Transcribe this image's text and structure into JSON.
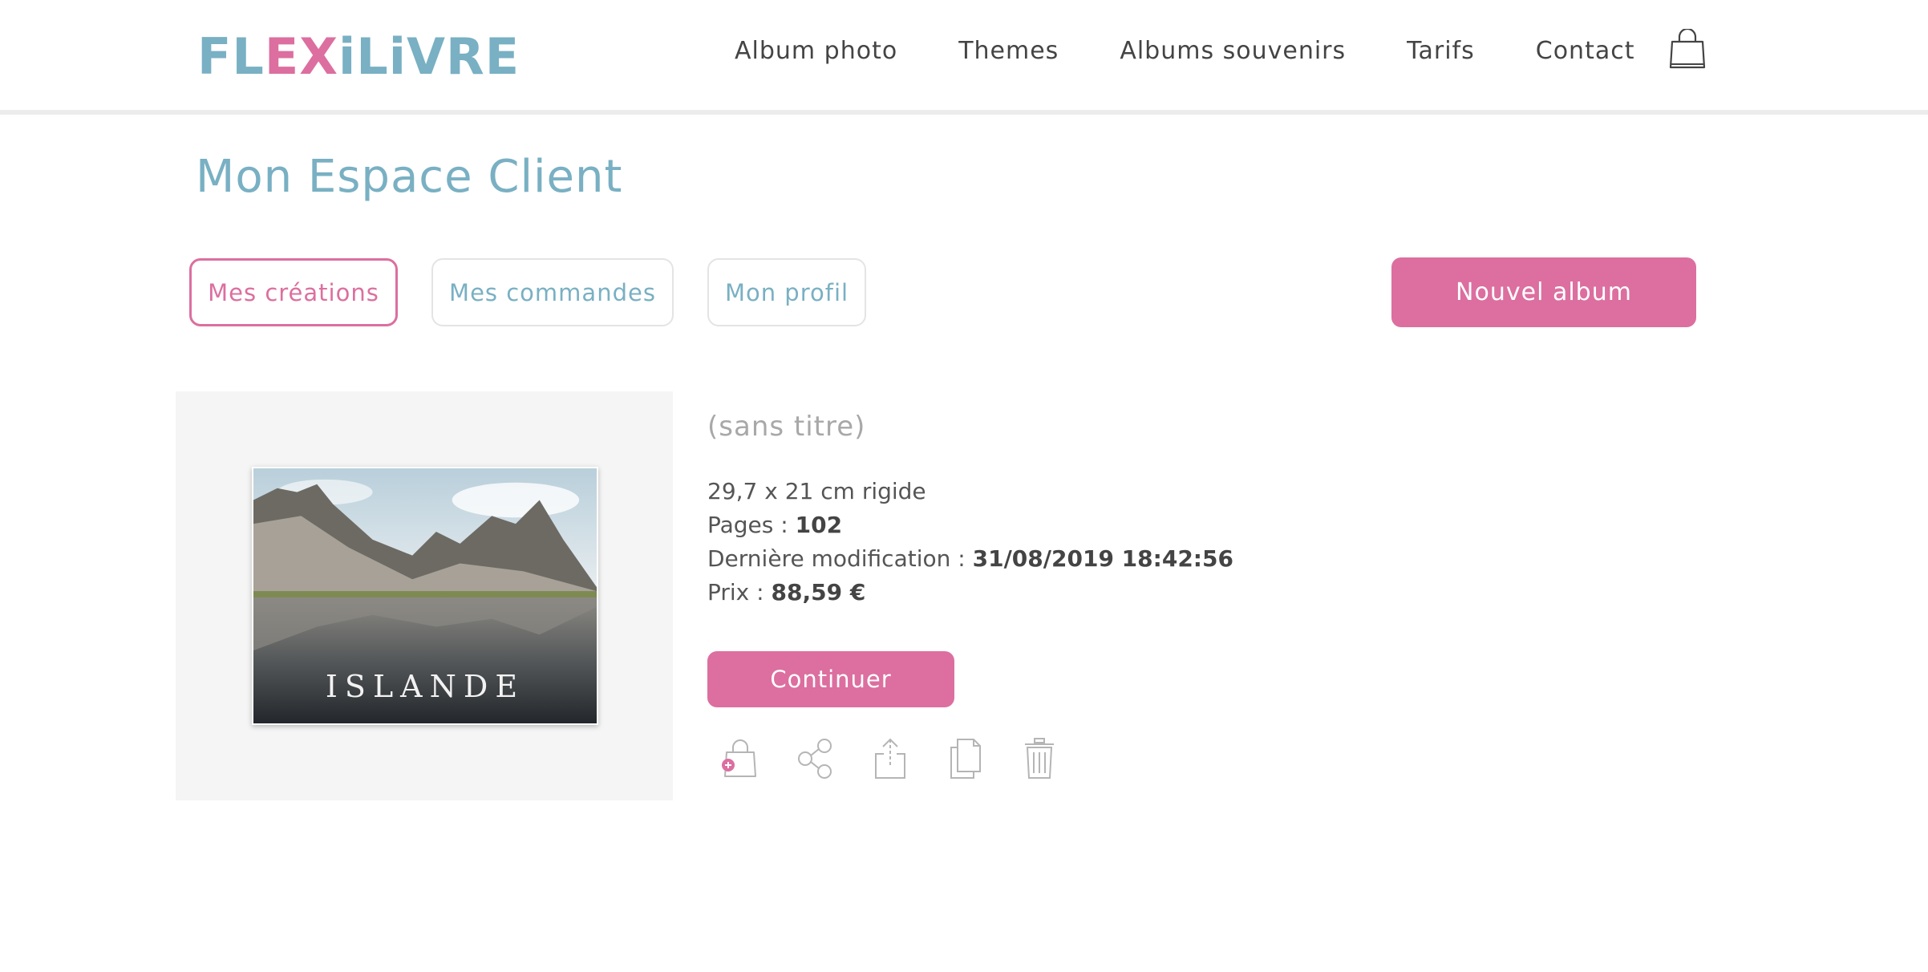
{
  "header": {
    "logo": {
      "part1": "FL",
      "part2": "EX",
      "part3": "iLiVRE"
    },
    "nav": [
      {
        "label": "Album photo"
      },
      {
        "label": "Themes"
      },
      {
        "label": "Albums souvenirs"
      },
      {
        "label": "Tarifs"
      },
      {
        "label": "Contact"
      }
    ],
    "cart_icon": "shopping-bag-icon"
  },
  "main": {
    "title": "Mon Espace Client",
    "tabs": [
      {
        "label": "Mes créations",
        "active": true
      },
      {
        "label": "Mes commandes",
        "active": false
      },
      {
        "label": "Mon profil",
        "active": false
      }
    ],
    "new_album_label": "Nouvel album",
    "album": {
      "cover_text": "ISLANDE",
      "title": "(sans titre)",
      "format": "29,7 x 21 cm rigide",
      "pages_label": "Pages : ",
      "pages_value": "102",
      "modified_label": "Dernière modification : ",
      "modified_value": "31/08/2019 18:42:56",
      "price_label": "Prix : ",
      "price_value": "88,59 €",
      "continue_label": "Continuer",
      "actions": [
        "add-to-cart-icon",
        "share-icon",
        "export-icon",
        "duplicate-icon",
        "trash-icon"
      ]
    }
  },
  "colors": {
    "accent_pink": "#dc6f9f",
    "accent_blue": "#79b0c3",
    "text_dark": "#444444",
    "icon_gray": "#b5b5b5"
  }
}
